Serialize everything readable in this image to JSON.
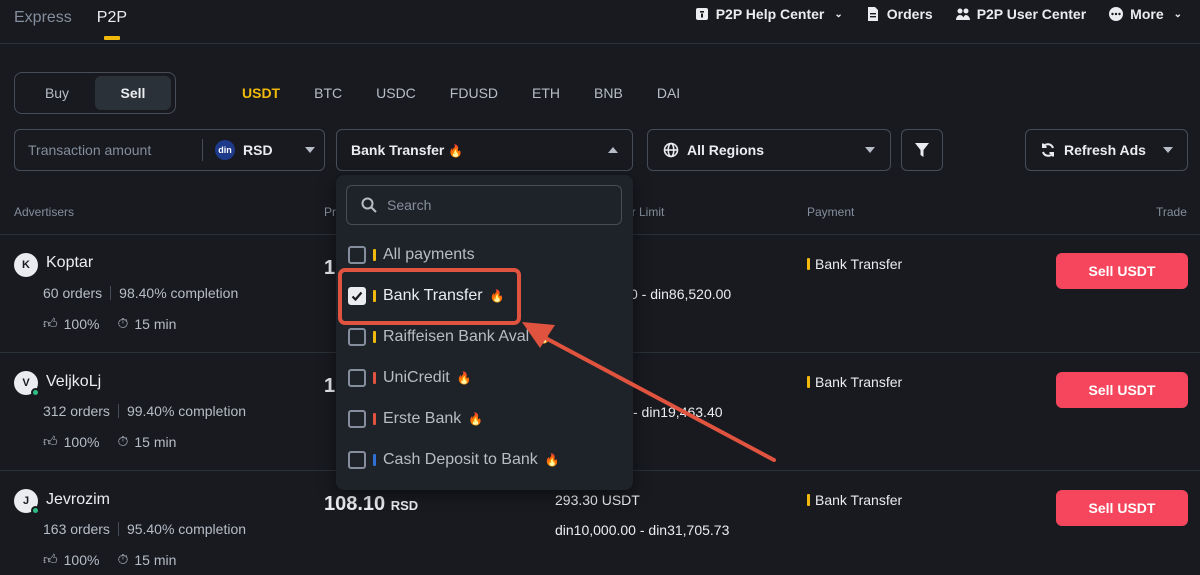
{
  "nav": {
    "tabs": [
      "Express",
      "P2P"
    ],
    "help_center": "P2P Help Center",
    "orders": "Orders",
    "user_center": "P2P User Center",
    "more": "More"
  },
  "toggle": {
    "buy": "Buy",
    "sell": "Sell"
  },
  "coins": [
    "USDT",
    "BTC",
    "USDC",
    "FDUSD",
    "ETH",
    "BNB",
    "DAI"
  ],
  "filters": {
    "amount_placeholder": "Transaction amount",
    "currency_icon": "din",
    "currency": "RSD",
    "payment": "Bank Transfer",
    "regions": "All Regions",
    "refresh": "Refresh Ads"
  },
  "table_headers": {
    "advertisers": "Advertisers",
    "price": "Pr",
    "limit": "er Limit",
    "payment": "Payment",
    "trade": "Trade"
  },
  "dropdown": {
    "search_placeholder": "Search",
    "items": [
      {
        "label": "All payments",
        "checked": false,
        "tag_color": "#f0b90b"
      },
      {
        "label": "Bank Transfer",
        "checked": true,
        "tag_color": "#f0b90b"
      },
      {
        "label": "Raiffeisen Bank Aval",
        "checked": false,
        "tag_color": "#f0b90b"
      },
      {
        "label": "UniCredit",
        "checked": false,
        "tag_color": "#e0533f"
      },
      {
        "label": "Erste Bank",
        "checked": false,
        "tag_color": "#e0533f"
      },
      {
        "label": "Cash Deposit to Bank",
        "checked": false,
        "tag_color": "#2f6fd6"
      }
    ]
  },
  "rows": [
    {
      "initial": "K",
      "name": "Koptar",
      "orders": "60 orders",
      "completion": "98.40% completion",
      "like": "100%",
      "time": "15 min",
      "price": "1",
      "currency": "",
      "available": "T",
      "limit": "0 - din86,520.00",
      "payment": "Bank Transfer",
      "button": "Sell USDT"
    },
    {
      "initial": "V",
      "name": "VeljkoLj",
      "orders": "312 orders",
      "completion": "99.40% completion",
      "like": "100%",
      "time": "15 min",
      "price": "1",
      "currency": "",
      "available": "T",
      "limit": "- din19,463.40",
      "payment": "Bank Transfer",
      "button": "Sell USDT"
    },
    {
      "initial": "J",
      "name": "Jevrozim",
      "orders": "163 orders",
      "completion": "95.40% completion",
      "like": "100%",
      "time": "15 min",
      "price": "108.10",
      "currency": "RSD",
      "available": "293.30 USDT",
      "limit": "din10,000.00 - din31,705.73",
      "payment": "Bank Transfer",
      "button": "Sell USDT"
    }
  ],
  "colors": {
    "accent": "#f0b90b",
    "sell": "#f6465d",
    "highlight": "#e0533f"
  }
}
